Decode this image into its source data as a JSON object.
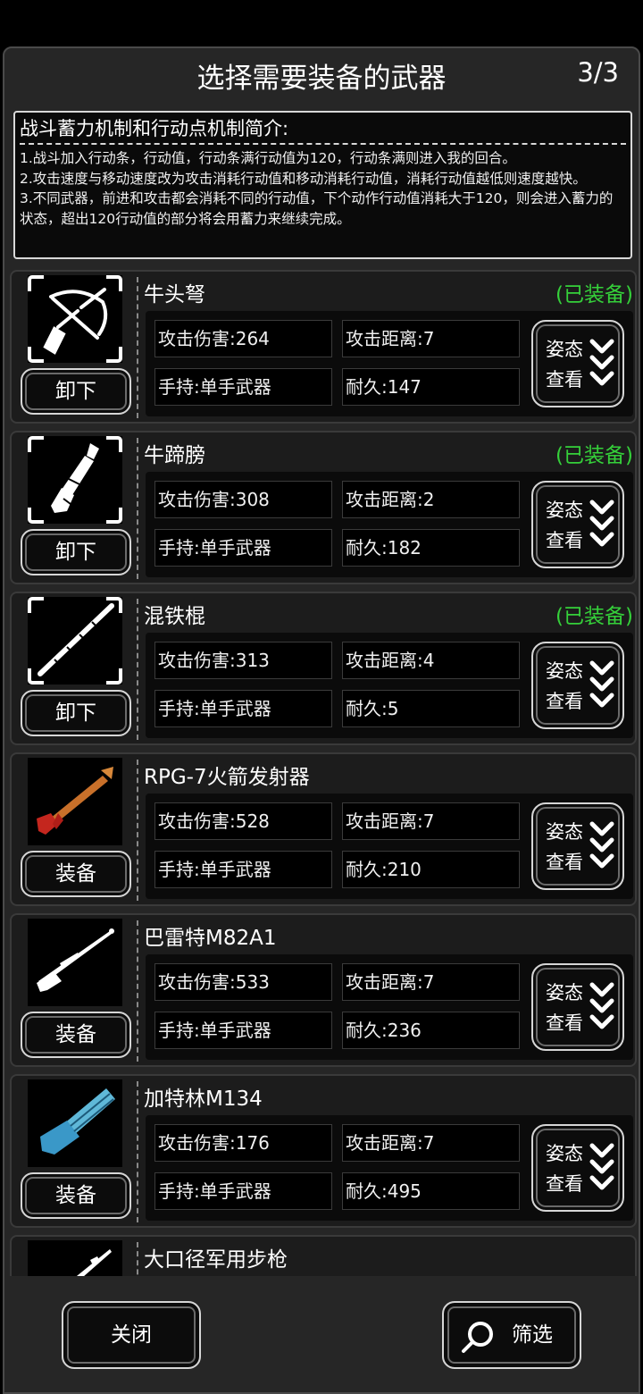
{
  "header": {
    "title": "选择需要装备的武器",
    "page_indicator": "3/3"
  },
  "intro": {
    "title": "战斗蓄力机制和行动点机制简介:",
    "lines": [
      "1.战斗加入行动条，行动值，行动条满行动值为120，行动条满则进入我的回合。",
      "2.攻击速度与移动速度改为攻击消耗行动值和移动消耗行动值，消耗行动值越低则速度越快。",
      "3.不同武器，前进和攻击都会消耗不同的行动值，下个动作行动值消耗大于120，则会进入蓄力的状态，超出120行动值的部分将会用蓄力来继续完成。"
    ]
  },
  "weapons": [
    {
      "name": "牛头弩",
      "equipped_tag": "(已装备)",
      "action": "卸下",
      "damage": "攻击伤害:264",
      "range": "攻击距离:7",
      "hand": "手持:单手武器",
      "durability": "耐久:147",
      "stance": [
        "姿态",
        "查看"
      ],
      "icon": "crossbow-icon"
    },
    {
      "name": "牛蹄膀",
      "equipped_tag": "(已装备)",
      "action": "卸下",
      "damage": "攻击伤害:308",
      "range": "攻击距离:2",
      "hand": "手持:单手武器",
      "durability": "耐久:182",
      "stance": [
        "姿态",
        "查看"
      ],
      "icon": "hoof-club-icon"
    },
    {
      "name": "混铁棍",
      "equipped_tag": "(已装备)",
      "action": "卸下",
      "damage": "攻击伤害:313",
      "range": "攻击距离:4",
      "hand": "手持:单手武器",
      "durability": "耐久:5",
      "stance": [
        "姿态",
        "查看"
      ],
      "icon": "iron-staff-icon"
    },
    {
      "name": "RPG-7火箭发射器",
      "equipped_tag": "",
      "action": "装备",
      "damage": "攻击伤害:528",
      "range": "攻击距离:7",
      "hand": "手持:单手武器",
      "durability": "耐久:210",
      "stance": [
        "姿态",
        "查看"
      ],
      "icon": "rocket-launcher-icon"
    },
    {
      "name": "巴雷特M82A1",
      "equipped_tag": "",
      "action": "装备",
      "damage": "攻击伤害:533",
      "range": "攻击距离:7",
      "hand": "手持:单手武器",
      "durability": "耐久:236",
      "stance": [
        "姿态",
        "查看"
      ],
      "icon": "sniper-rifle-icon"
    },
    {
      "name": "加特林M134",
      "equipped_tag": "",
      "action": "装备",
      "damage": "攻击伤害:176",
      "range": "攻击距离:7",
      "hand": "手持:单手武器",
      "durability": "耐久:495",
      "stance": [
        "姿态",
        "查看"
      ],
      "icon": "gatling-gun-icon"
    },
    {
      "name": "大口径军用步枪",
      "icon": "rifle-icon"
    }
  ],
  "footer": {
    "close_label": "关闭",
    "filter_label": "筛选"
  },
  "colors": {
    "equipped": "#35d03a",
    "panel": "#262626",
    "border": "#d6d6d6"
  }
}
